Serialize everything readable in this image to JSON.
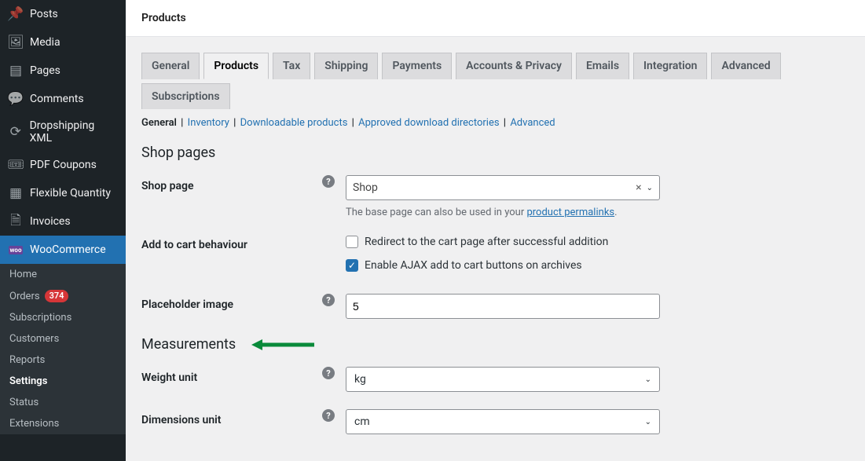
{
  "header": {
    "title": "Products"
  },
  "sidebar": {
    "items": [
      {
        "label": "Posts"
      },
      {
        "label": "Media"
      },
      {
        "label": "Pages"
      },
      {
        "label": "Comments"
      },
      {
        "label": "Dropshipping XML"
      },
      {
        "label": "PDF Coupons"
      },
      {
        "label": "Flexible Quantity"
      },
      {
        "label": "Invoices"
      },
      {
        "label": "WooCommerce"
      }
    ],
    "submenu": {
      "home": "Home",
      "orders": "Orders",
      "orders_count": "374",
      "subscriptions": "Subscriptions",
      "customers": "Customers",
      "reports": "Reports",
      "settings": "Settings",
      "status": "Status",
      "extensions": "Extensions"
    }
  },
  "tabs": {
    "items": [
      "General",
      "Products",
      "Tax",
      "Shipping",
      "Payments",
      "Accounts & Privacy",
      "Emails",
      "Integration",
      "Advanced",
      "Subscriptions"
    ]
  },
  "subtabs": {
    "general": "General",
    "inventory": "Inventory",
    "downloadable": "Downloadable products",
    "approved": "Approved download directories",
    "advanced": "Advanced"
  },
  "sections": {
    "shop_pages": "Shop pages",
    "measurements": "Measurements"
  },
  "fields": {
    "shop_page": {
      "label": "Shop page",
      "value": "Shop",
      "hint_pre": "The base page can also be used in your ",
      "hint_link": "product permalinks",
      "hint_post": "."
    },
    "add_to_cart": {
      "label": "Add to cart behaviour",
      "opt1": "Redirect to the cart page after successful addition",
      "opt2": "Enable AJAX add to cart buttons on archives"
    },
    "placeholder": {
      "label": "Placeholder image",
      "value": "5"
    },
    "weight": {
      "label": "Weight unit",
      "value": "kg"
    },
    "dimensions": {
      "label": "Dimensions unit",
      "value": "cm"
    }
  },
  "icons": {
    "clear": "×",
    "check": "✓"
  }
}
